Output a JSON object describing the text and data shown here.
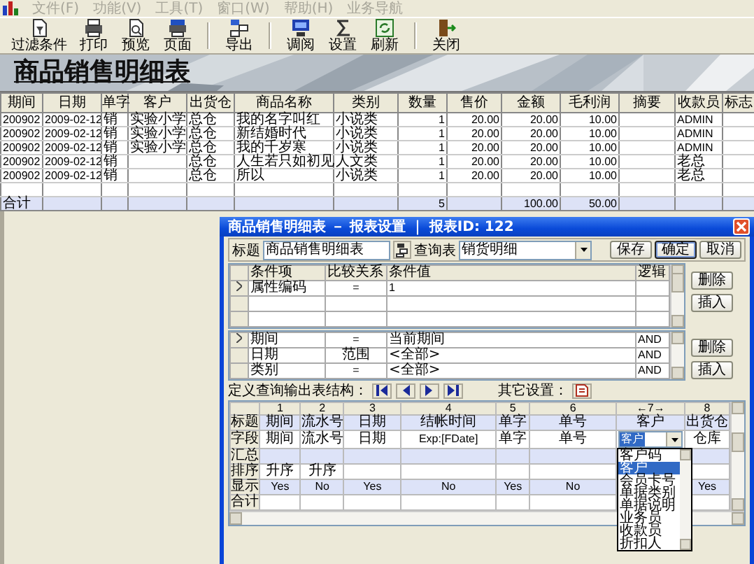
{
  "menu_bar": {
    "items": [
      {
        "label": "文件(F)",
        "disabled": true
      },
      {
        "label": "功能(V)",
        "disabled": true
      },
      {
        "label": "工具(T)",
        "disabled": true
      },
      {
        "label": "窗口(W)",
        "disabled": true
      },
      {
        "label": "帮助(H)",
        "disabled": true
      },
      {
        "label": "业务导航",
        "disabled": true
      }
    ]
  },
  "toolbar": {
    "groups": [
      [
        "过滤条件",
        "打印",
        "预览",
        "页面"
      ],
      [
        "导出"
      ],
      [
        "调阅",
        "设置",
        "刷新"
      ],
      [
        "关闭"
      ]
    ]
  },
  "banner": {
    "title": "商品销售明细表"
  },
  "table": {
    "columns": [
      "期间",
      "日期",
      "单字",
      "客户",
      "出货仓",
      "商品名称",
      "类别",
      "数量",
      "售价",
      "金额",
      "毛利润",
      "摘要",
      "收款员",
      "标志"
    ],
    "rows": [
      {
        "period": "200902",
        "date": "2009-02-12",
        "doc_type": "销",
        "customer": "实验小学",
        "warehouse": "总仓",
        "product": "我的名字叫红",
        "category": "小说类",
        "quantity": "1",
        "price": "20.00",
        "amount": "20.00",
        "gross_profit": "10.00",
        "cashier": "ADMIN"
      },
      {
        "period": "200902",
        "date": "2009-02-12",
        "doc_type": "销",
        "customer": "实验小学",
        "warehouse": "总仓",
        "product": "新结婚时代",
        "category": "小说类",
        "quantity": "1",
        "price": "20.00",
        "amount": "20.00",
        "gross_profit": "10.00",
        "cashier": "ADMIN"
      },
      {
        "period": "200902",
        "date": "2009-02-12",
        "doc_type": "销",
        "customer": "实验小学",
        "warehouse": "总仓",
        "product": "我的千岁寒",
        "category": "小说类",
        "quantity": "1",
        "price": "20.00",
        "amount": "20.00",
        "gross_profit": "10.00",
        "cashier": "ADMIN"
      },
      {
        "period": "200902",
        "date": "2009-02-12",
        "doc_type": "销",
        "warehouse": "总仓",
        "product": "人生若只如初见",
        "category": "人文类",
        "quantity": "1",
        "price": "20.00",
        "amount": "20.00",
        "gross_profit": "10.00",
        "cashier": "老总"
      },
      {
        "period": "200902",
        "date": "2009-02-12",
        "doc_type": "销",
        "warehouse": "总仓",
        "product": "所以",
        "category": "小说类",
        "quantity": "1",
        "price": "20.00",
        "amount": "20.00",
        "gross_profit": "10.00",
        "cashier": "老总"
      }
    ],
    "total_row": {
      "label": "合计",
      "quantity": "5",
      "amount": "100.00",
      "gross_profit": "50.00"
    }
  },
  "dialog": {
    "title": "商品销售明细表 － 报表设置 ｜ 报表ID: 122",
    "title_label": "标题",
    "title_value": "商品销售明细表",
    "query_label": "查询表",
    "query_value": "销货明细",
    "buttons": [
      {
        "label": "保存",
        "default": false
      },
      {
        "label": "确定",
        "default": true
      },
      {
        "label": "取消",
        "default": false
      }
    ],
    "conditions": {
      "columns": [
        "条件项",
        "比较关系",
        "条件值",
        "逻辑"
      ],
      "rows": [
        {
          "current": true,
          "item": "属性编码",
          "relation": "=",
          "value": "1"
        }
      ],
      "buttons": [
        "删除",
        "插入"
      ]
    },
    "filters": {
      "rows": [
        {
          "current": true,
          "item": "期间",
          "relation": "=",
          "value": "当前期间",
          "logic": "AND"
        },
        {
          "current": false,
          "item": "日期",
          "relation": "范围",
          "value": "<全部>",
          "logic": "AND"
        },
        {
          "current": false,
          "item": "类别",
          "relation": "=",
          "value": "<全部>",
          "logic": "AND"
        }
      ],
      "buttons": [
        "删除",
        "插入"
      ]
    },
    "structure": {
      "label": "定义查询输出表结构：",
      "other_label": "其它设置：",
      "row_labels": [
        "标题",
        "字段",
        "汇总",
        "排序",
        "显示",
        "合计"
      ],
      "columns": [
        {
          "number": "1",
          "title": "期间",
          "field": "期间",
          "sort": "升序",
          "show": "Yes"
        },
        {
          "number": "2",
          "title": "流水号",
          "field": "流水号",
          "sort": "升序",
          "show": "No"
        },
        {
          "number": "3",
          "title": "日期",
          "field": "日期",
          "show": "Yes"
        },
        {
          "number": "4",
          "title": "结帐时间",
          "field": "Exp:[FDate]",
          "show": "No"
        },
        {
          "number": "5",
          "title": "单字",
          "field": "单字",
          "show": "Yes"
        },
        {
          "number": "6",
          "title": "单号",
          "field": "单号",
          "show": "No"
        },
        {
          "number": "←7→",
          "title": "客户",
          "field_dropdown": {
            "value": "客户",
            "open": true,
            "items": [
              {
                "label": "客户码",
                "selected": false
              },
              {
                "label": "客户",
                "selected": true
              },
              {
                "label": "会员卡号",
                "selected": false
              },
              {
                "label": "单据类别",
                "selected": false
              },
              {
                "label": "单据说明",
                "selected": false
              },
              {
                "label": "业务员",
                "selected": false
              },
              {
                "label": "收款员",
                "selected": false
              },
              {
                "label": "折扣人",
                "selected": false
              }
            ]
          }
        },
        {
          "number": "8",
          "title": "出货仓",
          "field": "仓库",
          "show": "Yes"
        }
      ]
    }
  }
}
